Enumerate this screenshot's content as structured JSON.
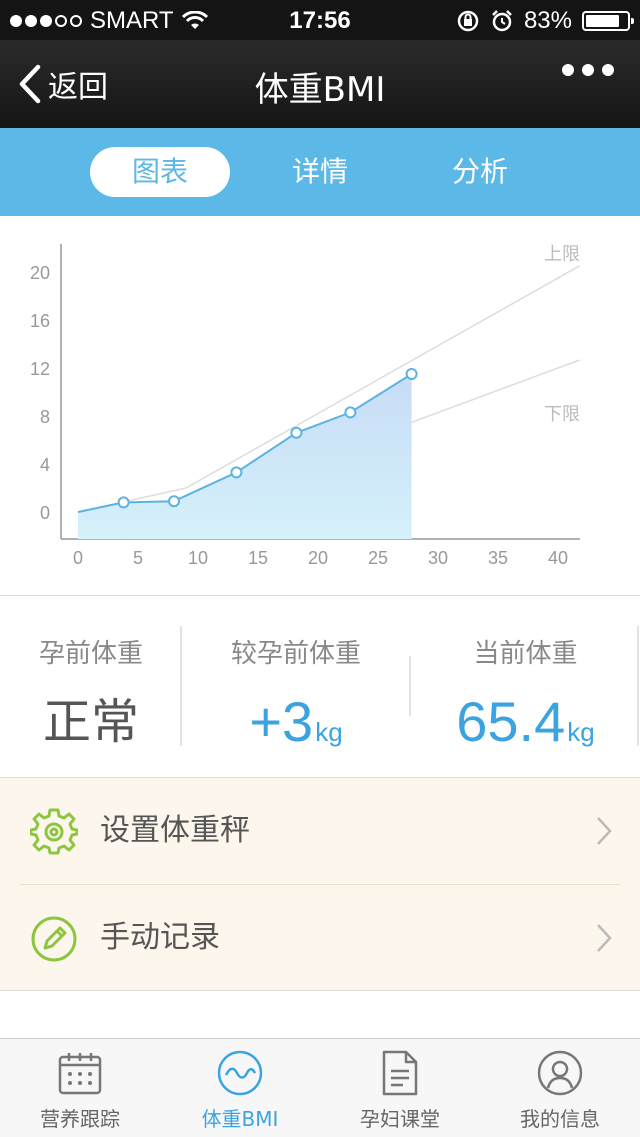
{
  "status_bar": {
    "carrier": "SMART",
    "time": "17:56",
    "battery_percent": "83%",
    "battery_level": 0.83,
    "signal_bars_filled": 3,
    "signal_bars_total": 5
  },
  "nav": {
    "back_label": "返回",
    "title": "体重BMI"
  },
  "tabs": [
    {
      "label": "图表",
      "active": true
    },
    {
      "label": "详情",
      "active": false
    },
    {
      "label": "分析",
      "active": false
    }
  ],
  "chart_data": {
    "type": "area",
    "x_ticks": [
      "0",
      "5",
      "10",
      "15",
      "20",
      "25",
      "30",
      "35",
      "40"
    ],
    "y_ticks": [
      "0",
      "4",
      "8",
      "12",
      "16",
      "20"
    ],
    "xlim": [
      0,
      40
    ],
    "ylim": [
      0,
      20
    ],
    "upper_limit_label": "上限",
    "lower_limit_label": "下限",
    "series": [
      {
        "x": [
          0,
          3.8,
          8,
          13.2,
          18.2,
          22.7,
          27.8
        ],
        "y": [
          0,
          0.8,
          0.9,
          3.3,
          6.6,
          8.3,
          11.5
        ]
      }
    ],
    "upper_limit": {
      "x": [
        0,
        9,
        40
      ],
      "y": [
        0,
        2,
        19.5
      ]
    },
    "lower_limit": {
      "x": [
        0,
        9,
        40
      ],
      "y": [
        0,
        0.5,
        12
      ]
    },
    "colors": {
      "line": "#5cb3e0",
      "fill_top": "#c7dcf6",
      "fill_bottom": "#d5f1fb",
      "limit": "#dddddd"
    }
  },
  "stats": {
    "pre_weight": {
      "label": "孕前体重",
      "value": "正常"
    },
    "change": {
      "label": "较孕前体重",
      "value": "+3",
      "unit": "kg"
    },
    "current": {
      "label": "当前体重",
      "value": "65.4",
      "unit": "kg"
    }
  },
  "menu": [
    {
      "label": "设置体重秤",
      "icon": "gear-icon"
    },
    {
      "label": "手动记录",
      "icon": "pencil-icon"
    }
  ],
  "bottom_tabs": [
    {
      "label": "营养跟踪",
      "icon": "calendar-icon",
      "active": false
    },
    {
      "label": "体重BMI",
      "icon": "wave-icon",
      "active": true
    },
    {
      "label": "孕妇课堂",
      "icon": "document-icon",
      "active": false
    },
    {
      "label": "我的信息",
      "icon": "profile-icon",
      "active": false
    }
  ],
  "colors": {
    "accent": "#3aa3e0",
    "tab_bg": "#5cb8e6",
    "icon_green": "#8cc63f"
  }
}
